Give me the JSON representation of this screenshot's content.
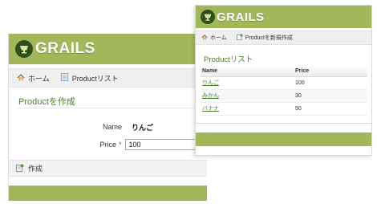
{
  "brand": {
    "name": "GRAILS",
    "header_color": "#a2b75a",
    "link_color": "#48802c"
  },
  "create_page": {
    "nav": {
      "home_label": "ホーム",
      "home_icon": "home-icon",
      "list_label": "Productリスト",
      "list_icon": "list-icon"
    },
    "heading": "Productを作成",
    "fields": {
      "name": {
        "label": "Name",
        "value": "りんご"
      },
      "price": {
        "label": "Price",
        "required_mark": "*",
        "value": "100"
      }
    },
    "create_button": {
      "label": "作成",
      "icon": "create-icon"
    }
  },
  "list_page": {
    "nav": {
      "home_label": "ホーム",
      "home_icon": "home-icon",
      "new_label": "Productを新規作成",
      "new_icon": "add-icon"
    },
    "heading": "Productリスト",
    "table": {
      "columns": [
        "Name",
        "Price"
      ],
      "rows": [
        {
          "name": "りんご",
          "price": "100"
        },
        {
          "name": "みかん",
          "price": "30"
        },
        {
          "name": "バナナ",
          "price": "50"
        }
      ]
    }
  }
}
